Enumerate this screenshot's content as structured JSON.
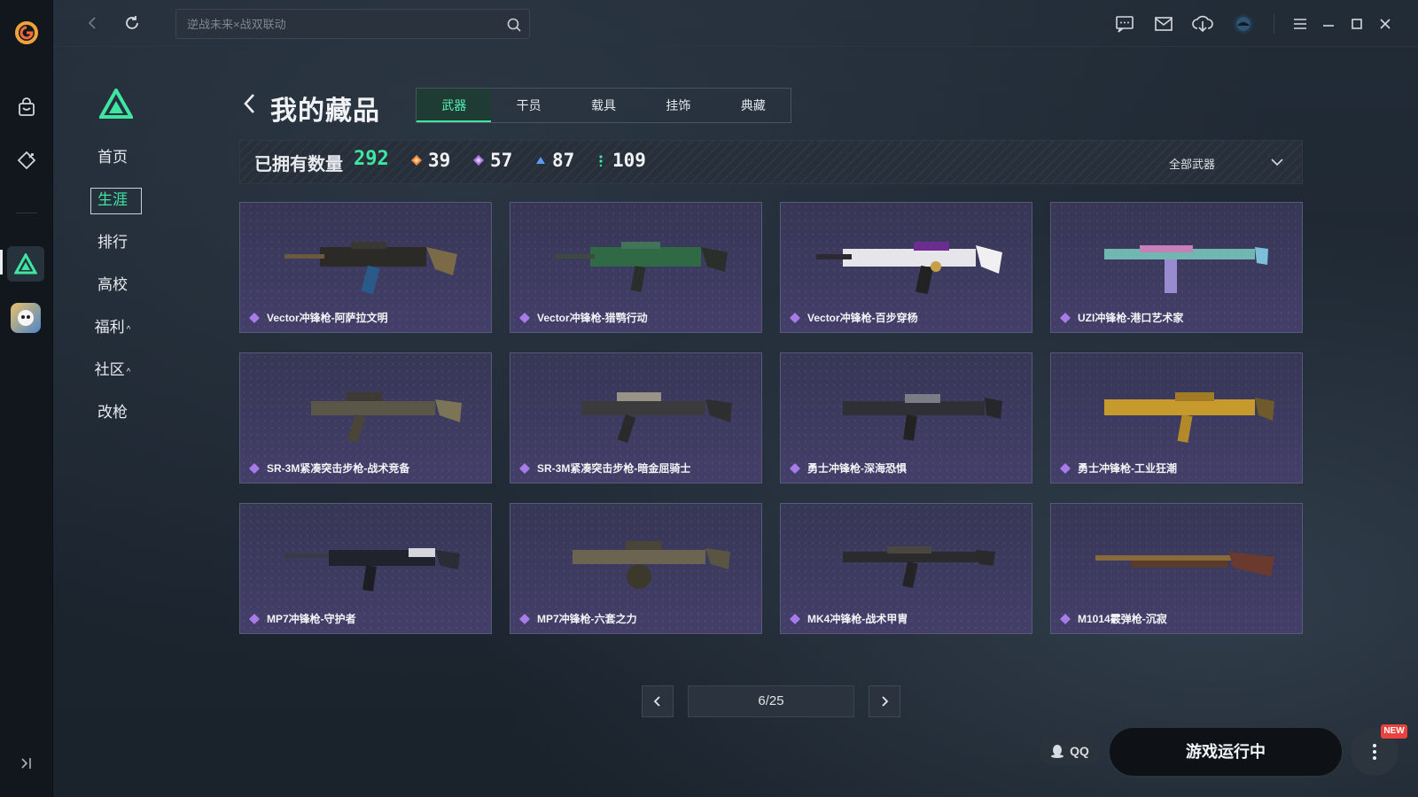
{
  "topbar": {
    "search_placeholder": "逆战未来×战双联动"
  },
  "sidenav": {
    "items": [
      {
        "label": "首页"
      },
      {
        "label": "生涯",
        "active": true
      },
      {
        "label": "排行"
      },
      {
        "label": "高校"
      },
      {
        "label": "福利",
        "caret": "^"
      },
      {
        "label": "社区",
        "caret": "^"
      },
      {
        "label": "改枪"
      }
    ]
  },
  "header": {
    "title": "我的藏品",
    "tabs": [
      {
        "label": "武器",
        "active": true
      },
      {
        "label": "干员"
      },
      {
        "label": "载具"
      },
      {
        "label": "挂饰"
      },
      {
        "label": "典藏"
      }
    ]
  },
  "stats": {
    "owned_label": "已拥有数量",
    "owned_count": "292",
    "rarities": [
      {
        "count": "39",
        "color": "#f08a3c"
      },
      {
        "count": "57",
        "color": "#a77be8"
      },
      {
        "count": "87",
        "color": "#5b9cf0"
      },
      {
        "count": "109",
        "color": "#3ee6a2"
      }
    ],
    "filter_label": "全部武器"
  },
  "items": [
    {
      "name": "Vector冲锋枪-阿萨拉文明"
    },
    {
      "name": "Vector冲锋枪-猎鹗行动"
    },
    {
      "name": "Vector冲锋枪-百步穿杨"
    },
    {
      "name": "UZI冲锋枪-港口艺术家"
    },
    {
      "name": "SR-3M紧凑突击步枪-战术竞备"
    },
    {
      "name": "SR-3M紧凑突击步枪-暗金屈骑士"
    },
    {
      "name": "勇士冲锋枪-深海恐惧"
    },
    {
      "name": "勇士冲锋枪-工业狂潮"
    },
    {
      "name": "MP7冲锋枪-守护者"
    },
    {
      "name": "MP7冲锋枪-六套之力"
    },
    {
      "name": "MK4冲锋枪-战术甲胄"
    },
    {
      "name": "M1014霰弹枪-沉寂"
    }
  ],
  "pager": {
    "label": "6/25"
  },
  "bottom": {
    "qq_label": "QQ",
    "launch_label": "游戏运行中",
    "new_badge": "NEW"
  },
  "colors": {
    "accent": "#3ee6a2",
    "epic": "#a77be8"
  }
}
